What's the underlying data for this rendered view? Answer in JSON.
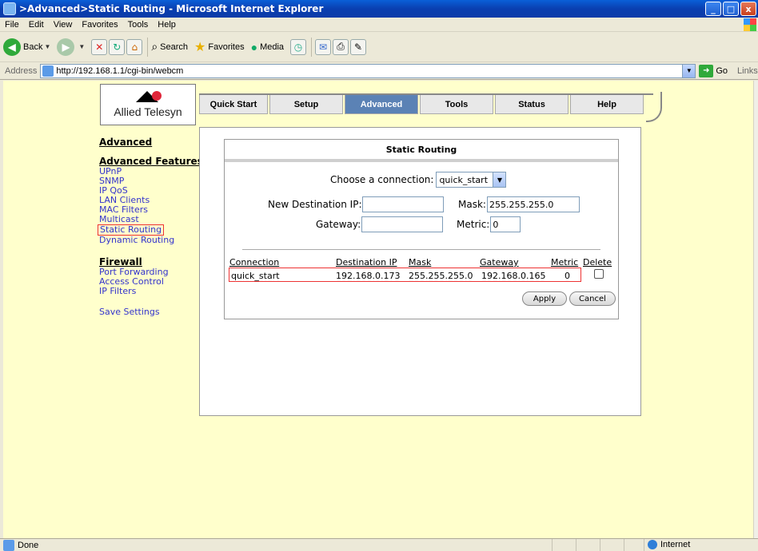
{
  "window": {
    "title": ">Advanced>Static Routing - Microsoft Internet Explorer",
    "min": "_",
    "max": "□",
    "close": "x"
  },
  "menu": [
    "File",
    "Edit",
    "View",
    "Favorites",
    "Tools",
    "Help"
  ],
  "toolbar": {
    "back": "Back",
    "search": "Search",
    "favorites": "Favorites",
    "media": "Media"
  },
  "address": {
    "label": "Address",
    "url": "http://192.168.1.1/cgi-bin/webcm",
    "go": "Go",
    "links": "Links"
  },
  "logo": {
    "text": "Allied Telesyn"
  },
  "tabs": [
    {
      "label": "Quick Start",
      "active": false
    },
    {
      "label": "Setup",
      "active": false
    },
    {
      "label": "Advanced",
      "active": true
    },
    {
      "label": "Tools",
      "active": false
    },
    {
      "label": "Status",
      "active": false
    },
    {
      "label": "Help",
      "active": false
    }
  ],
  "nav": {
    "advanced": "Advanced",
    "features_heading": "Advanced Features",
    "features": [
      "UPnP",
      "SNMP",
      "IP QoS",
      "LAN Clients",
      "MAC Filters",
      "Multicast",
      "Static Routing",
      "Dynamic Routing"
    ],
    "firewall_heading": "Firewall",
    "firewall": [
      "Port Forwarding",
      "Access Control",
      "IP Filters"
    ],
    "save": "Save Settings"
  },
  "form": {
    "title": "Static Routing",
    "connection_label": "Choose a connection:",
    "connection_value": "quick_start",
    "dest_label": "New Destination IP:",
    "dest_value": "",
    "mask_label": "Mask:",
    "mask_value": "255.255.255.0",
    "gateway_label": "Gateway:",
    "gateway_value": "",
    "metric_label": "Metric:",
    "metric_value": "0"
  },
  "table": {
    "headers": {
      "connection": "Connection",
      "dest": "Destination IP",
      "mask": "Mask",
      "gateway": "Gateway",
      "metric": "Metric",
      "delete": "Delete"
    },
    "row": {
      "connection": "quick_start",
      "dest": "192.168.0.173",
      "mask": "255.255.255.0",
      "gateway": "192.168.0.165",
      "metric": "0"
    }
  },
  "buttons": {
    "apply": "Apply",
    "cancel": "Cancel"
  },
  "status": {
    "left": "Done",
    "zone": "Internet"
  }
}
